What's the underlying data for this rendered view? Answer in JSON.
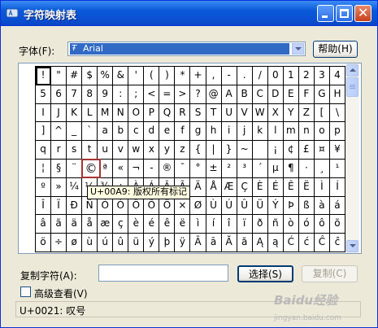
{
  "window": {
    "title": "字符映射表"
  },
  "font": {
    "label": "字体(F):",
    "tt_mark": "Ŧ",
    "selected": "Arial"
  },
  "help_button": "帮助(H)",
  "grid": {
    "rows": [
      [
        "!",
        "\"",
        "#",
        "$",
        "%",
        "&",
        "'",
        "(",
        ")",
        "*",
        "+",
        ",",
        "-",
        ".",
        "/",
        "0",
        "1",
        "2",
        "3",
        "4"
      ],
      [
        "5",
        "6",
        "7",
        "8",
        "9",
        ":",
        ";",
        "<",
        "=",
        ">",
        "?",
        "@",
        "A",
        "B",
        "C",
        "D",
        "E",
        "F",
        "G",
        "H"
      ],
      [
        "I",
        "J",
        "K",
        "L",
        "M",
        "N",
        "O",
        "P",
        "Q",
        "R",
        "S",
        "T",
        "U",
        "V",
        "W",
        "X",
        "Y",
        "Z",
        "[",
        "\\"
      ],
      [
        "]",
        "^",
        "_",
        "`",
        "a",
        "b",
        "c",
        "d",
        "e",
        "f",
        "g",
        "h",
        "i",
        "j",
        "k",
        "l",
        "m",
        "n",
        "o",
        "p"
      ],
      [
        "q",
        "r",
        "s",
        "t",
        "u",
        "v",
        "w",
        "x",
        "y",
        "z",
        "{",
        "|",
        "}",
        "~",
        " ",
        "¡",
        "¢",
        "£",
        "¤",
        "¥"
      ],
      [
        "¦",
        "§",
        "¨",
        "©",
        "ª",
        "«",
        "¬",
        "-",
        "®",
        "¯",
        "°",
        "±",
        "²",
        "³",
        "´",
        "µ",
        "¶",
        "·",
        "¸",
        "¹"
      ],
      [
        "º",
        "»",
        "¼",
        "½",
        "¾",
        "¿",
        "À",
        "Á",
        "Â",
        "Ã",
        "Ä",
        "Å",
        "Æ",
        "Ç",
        "È",
        "É",
        "Ê",
        "Ë",
        "Ì",
        "Í"
      ],
      [
        "Î",
        "Ï",
        "Ð",
        "Ñ",
        "Ò",
        "Ó",
        "Ô",
        "Õ",
        "Ö",
        "×",
        "Ø",
        "Ù",
        "Ú",
        "Û",
        "Ü",
        "Ý",
        "Þ",
        "ß",
        "à",
        "á"
      ],
      [
        "â",
        "ã",
        "ä",
        "å",
        "æ",
        "ç",
        "è",
        "é",
        "ê",
        "ë",
        "ì",
        "í",
        "î",
        "ï",
        "ð",
        "ñ",
        "ò",
        "ó",
        "ô",
        "õ"
      ],
      [
        "ö",
        "÷",
        "ø",
        "ù",
        "ú",
        "û",
        "ü",
        "ý",
        "þ",
        "ÿ",
        "Ā",
        "ā",
        "Ă",
        "ă",
        "Ą",
        "ą",
        "Ć",
        "ć",
        "Ĉ",
        "ĉ"
      ]
    ],
    "selected_char": "!",
    "magnified_char": "©",
    "tooltip": "U+00A9: 版权所有标记"
  },
  "copy_chars": {
    "label": "复制字符(A):",
    "value": ""
  },
  "select_button": "选择(S)",
  "copy_button": "复制(C)",
  "advanced_view": {
    "label": "高级查看(V)",
    "checked": false
  },
  "status": "U+0021: 叹号",
  "watermark": {
    "main": "Baidu经验",
    "sub": "jingyan.baidu.com"
  },
  "colors": {
    "title_bar": "#0a5ad8",
    "selection": "#316ac5",
    "magnifier_border": "#a83232",
    "tooltip_bg": "#ffffe1"
  }
}
